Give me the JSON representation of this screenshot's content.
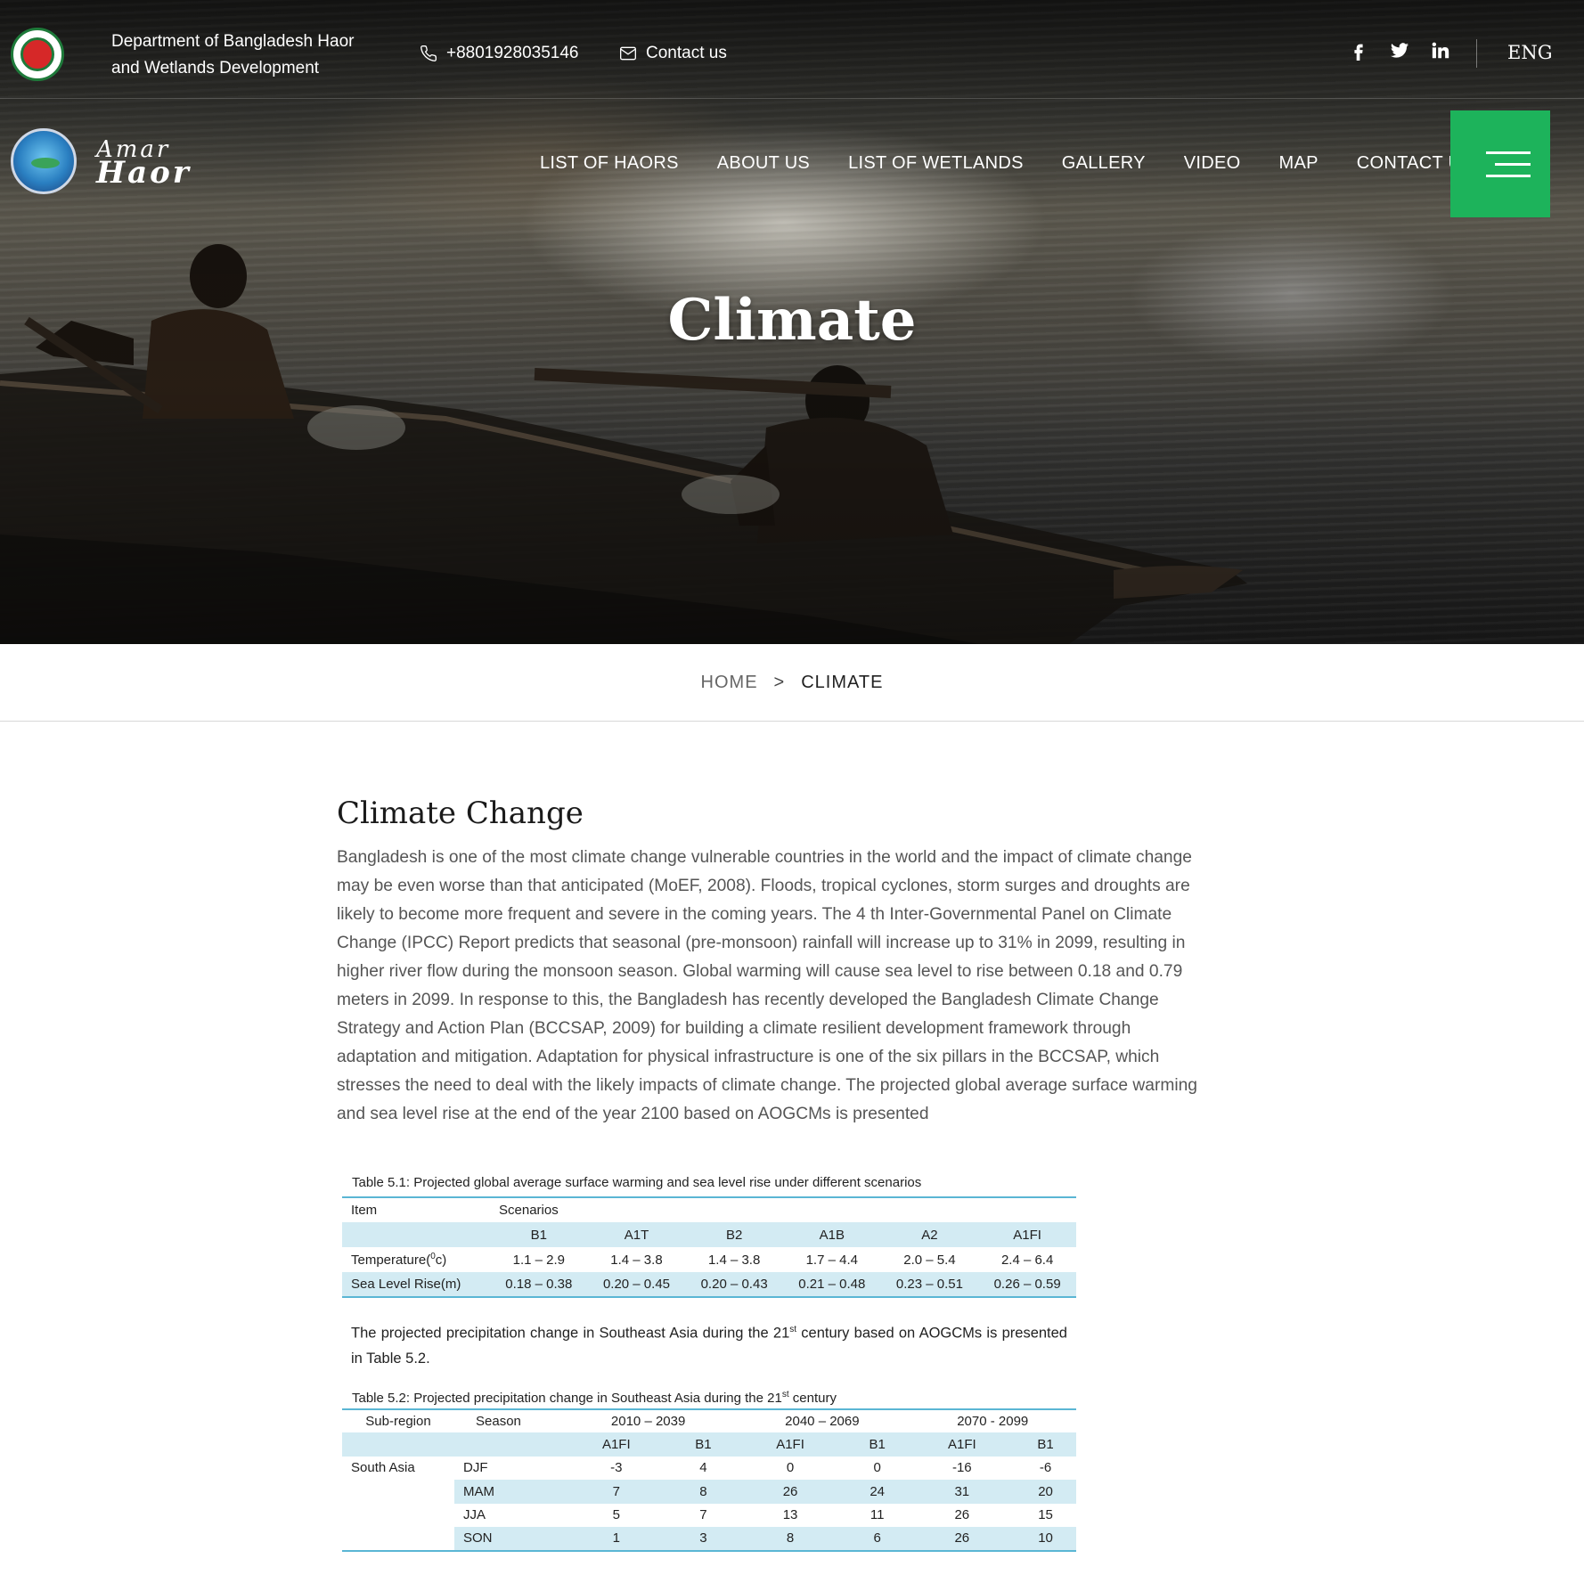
{
  "topbar": {
    "department": "Department of Bangladesh Haor and Wetlands Development",
    "phone": "+8801928035146",
    "contact": "Contact us",
    "language": "ENG"
  },
  "brand": {
    "line1": "Amar",
    "line2": "Haor"
  },
  "nav": [
    "LIST OF HAORS",
    "ABOUT US",
    "LIST OF WETLANDS",
    "GALLERY",
    "VIDEO",
    "MAP",
    "CONTACT US"
  ],
  "hero": {
    "title": "Climate"
  },
  "breadcrumb": {
    "home": "HOME",
    "separator": ">",
    "current": "CLIMATE"
  },
  "article": {
    "heading": "Climate Change",
    "body": "Bangladesh is one of the most climate change vulnerable countries in the world and the impact of climate change may be even worse than that anticipated (MoEF, 2008). Floods, tropical cyclones, storm surges and droughts are likely to become more frequent and severe in the coming years. The 4 th Inter-Governmental Panel on Climate Change (IPCC) Report predicts that seasonal (pre-monsoon) rainfall will increase up to 31% in 2099, resulting in higher river flow during the monsoon season. Global warming will cause sea level to rise between 0.18 and 0.79 meters in 2099. In response to this, the Bangladesh has recently developed the Bangladesh Climate Change Strategy and Action Plan (BCCSAP, 2009) for building a climate resilient development framework through adaptation and mitigation. Adaptation for physical infrastructure is one of the six pillars in the BCCSAP, which stresses the need to deal with the likely impacts of climate change. The projected global average surface warming and sea level rise at the end of the year 2100 based on AOGCMs is presented"
  },
  "table1": {
    "caption": "Table 5.1: Projected global average surface warming and sea level rise under different scenarios",
    "item_header": "Item",
    "scenarios_header": "Scenarios",
    "scenarios": [
      "B1",
      "A1T",
      "B2",
      "A1B",
      "A2",
      "A1FI"
    ],
    "rows": [
      {
        "label": "Temperature(",
        "label_sup": "0",
        "label_tail": "c)",
        "values": [
          "1.1 – 2.9",
          "1.4 – 3.8",
          "1.4 – 3.8",
          "1.7 – 4.4",
          "2.0 – 5.4",
          "2.4 – 6.4"
        ]
      },
      {
        "label": "Sea Level Rise(m)",
        "values": [
          "0.18 – 0.38",
          "0.20 – 0.45",
          "0.20 – 0.43",
          "0.21 – 0.48",
          "0.23 – 0.51",
          "0.26 – 0.59"
        ]
      }
    ]
  },
  "interlude": {
    "part1": "The projected precipitation change in Southeast Asia during the 21",
    "sup": "st",
    "part2": " century based on AOGCMs is presented in Table 5.2."
  },
  "table2": {
    "caption_part1": "Table 5.2: Projected precipitation change in Southeast Asia during the 21",
    "caption_sup": "st",
    "caption_part2": " century",
    "headers": {
      "subregion": "Sub-region",
      "season": "Season",
      "p1": "2010 – 2039",
      "p2": "2040 – 2069",
      "p3": "2070 - 2099"
    },
    "subheaders": [
      "A1FI",
      "B1",
      "A1FI",
      "B1",
      "A1FI",
      "B1"
    ],
    "subregion": "South Asia",
    "rows": [
      {
        "season": "DJF",
        "values": [
          "-3",
          "4",
          "0",
          "0",
          "-16",
          "-6"
        ]
      },
      {
        "season": "MAM",
        "values": [
          "7",
          "8",
          "26",
          "24",
          "31",
          "20"
        ]
      },
      {
        "season": "JJA",
        "values": [
          "5",
          "7",
          "13",
          "11",
          "26",
          "15"
        ]
      },
      {
        "season": "SON",
        "values": [
          "1",
          "3",
          "8",
          "6",
          "26",
          "10"
        ]
      }
    ]
  }
}
